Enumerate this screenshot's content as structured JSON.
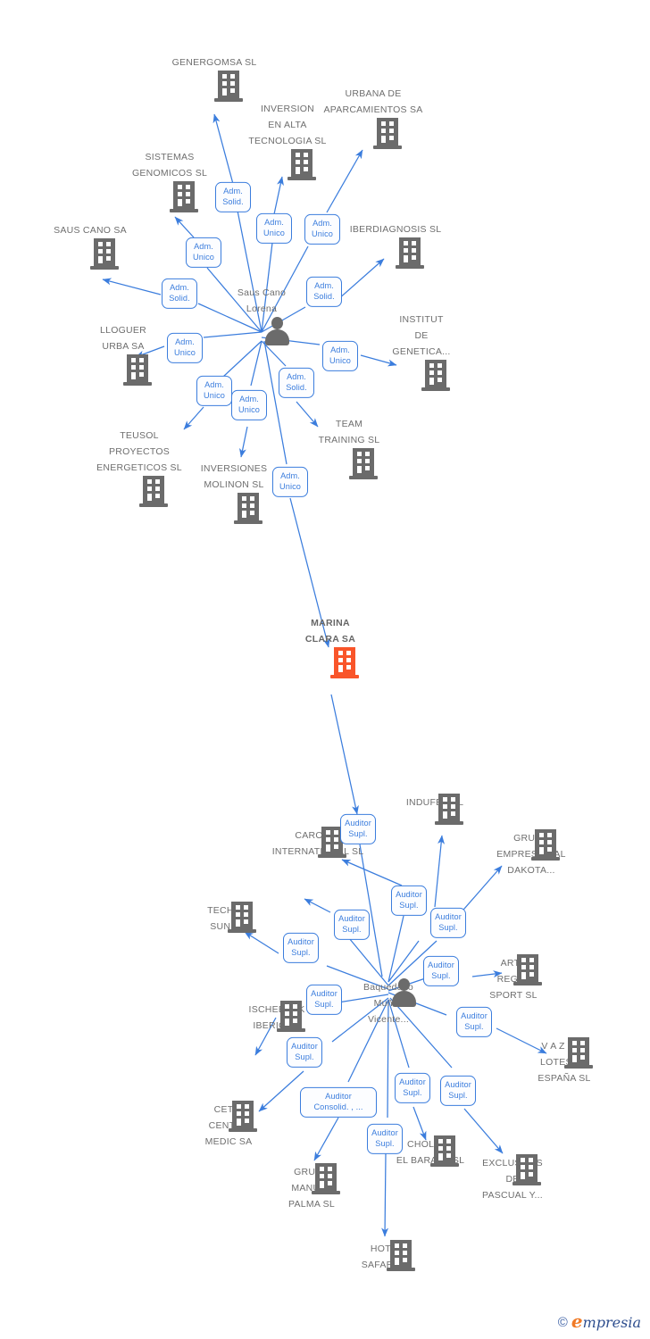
{
  "meta": {
    "colors": {
      "node_grey": "#6b6b6b",
      "focus_orange": "#f9552a",
      "edge_blue": "#3b7ddd",
      "label_text": "#6e6e6e",
      "chip_text": "#3b7ddd",
      "background": "#ffffff"
    }
  },
  "focus": {
    "label": "MARINA\nCLARA SA",
    "icon": "building-icon",
    "color": "#f9552a"
  },
  "people": [
    {
      "id": "p1",
      "label": "Saus Cano\nLorena",
      "icon": "person-icon"
    },
    {
      "id": "p2",
      "label": "Baquedano\nMuñoz\nVicente...",
      "icon": "person-icon"
    }
  ],
  "companies": [
    {
      "id": "c01",
      "label": "GENERGOMSA SL",
      "icon": "building-icon"
    },
    {
      "id": "c02",
      "label": "INVERSION\nEN ALTA\nTECNOLOGIA SL",
      "icon": "building-icon"
    },
    {
      "id": "c03",
      "label": "URBANA DE\nAPARCAMIENTOS SA",
      "icon": "building-icon"
    },
    {
      "id": "c04",
      "label": "SISTEMAS\nGENOMICOS SL",
      "icon": "building-icon"
    },
    {
      "id": "c05",
      "label": "IBERDIAGNOSIS SL",
      "icon": "building-icon"
    },
    {
      "id": "c06",
      "label": "SAUS CANO SA",
      "icon": "building-icon"
    },
    {
      "id": "c07",
      "label": "INSTITUT\nDE\nGENETICA...",
      "icon": "building-icon"
    },
    {
      "id": "c08",
      "label": "LLOGUER\nURBA SA",
      "icon": "building-icon"
    },
    {
      "id": "c09",
      "label": "TEUSOL\nPROYECTOS\nENERGETICOS SL",
      "icon": "building-icon"
    },
    {
      "id": "c10",
      "label": "INVERSIONES\nMOLINON SL",
      "icon": "building-icon"
    },
    {
      "id": "c11",
      "label": "TEAM\nTRAINING SL",
      "icon": "building-icon"
    },
    {
      "id": "c12",
      "label": "CAROLAY\nINTERNATIONAL SL",
      "icon": "building-icon"
    },
    {
      "id": "c13",
      "label": "INDUFEX SL",
      "icon": "building-icon"
    },
    {
      "id": "c14",
      "label": "GRUPO\nEMPRESARIAL\nDAKOTA...",
      "icon": "building-icon"
    },
    {
      "id": "c15",
      "label": "TECHNO\nSUN SL",
      "icon": "building-icon"
    },
    {
      "id": "c16",
      "label": "ARTE\nREGAL\nSPORT SL",
      "icon": "building-icon"
    },
    {
      "id": "c17",
      "label": "ISCHEBECK\nIBERICA...",
      "icon": "building-icon"
    },
    {
      "id": "c18",
      "label": "V A Z LOS\nLOTES DE\nESPAÑA SL",
      "icon": "building-icon"
    },
    {
      "id": "c19",
      "label": "CETIR\nCENTRE\nMEDIC SA",
      "icon": "building-icon"
    },
    {
      "id": "c20",
      "label": "GRUPO\nMANUEL\nPALMA SL",
      "icon": "building-icon"
    },
    {
      "id": "c21",
      "label": "CHOLLOS\nEL BARATO SL",
      "icon": "building-icon"
    },
    {
      "id": "c22",
      "label": "EXCLUSIVAS\nDE\nPASCUAL Y...",
      "icon": "building-icon"
    },
    {
      "id": "c23",
      "label": "HOTEL\nSAFARI SA",
      "icon": "building-icon"
    }
  ],
  "relations": [
    {
      "id": "r01",
      "label": "Adm.\nSolid."
    },
    {
      "id": "r02",
      "label": "Adm.\nUnico"
    },
    {
      "id": "r03",
      "label": "Adm.\nUnico"
    },
    {
      "id": "r04",
      "label": "Adm.\nUnico"
    },
    {
      "id": "r05",
      "label": "Adm.\nSolid."
    },
    {
      "id": "r06",
      "label": "Adm.\nSolid."
    },
    {
      "id": "r07",
      "label": "Adm.\nUnico"
    },
    {
      "id": "r08",
      "label": "Adm.\nUnico"
    },
    {
      "id": "r09",
      "label": "Adm.\nUnico"
    },
    {
      "id": "r10",
      "label": "Adm.\nUnico"
    },
    {
      "id": "r11",
      "label": "Adm.\nSolid."
    },
    {
      "id": "r12",
      "label": "Adm.\nUnico"
    },
    {
      "id": "r13",
      "label": "Auditor\nSupl."
    },
    {
      "id": "r14",
      "label": "Auditor\nSupl."
    },
    {
      "id": "r15",
      "label": "Auditor\nSupl."
    },
    {
      "id": "r16",
      "label": "Auditor\nSupl."
    },
    {
      "id": "r17",
      "label": "Auditor\nSupl."
    },
    {
      "id": "r18",
      "label": "Auditor\nSupl."
    },
    {
      "id": "r19",
      "label": "Auditor\nSupl."
    },
    {
      "id": "r20",
      "label": "Auditor\nSupl."
    },
    {
      "id": "r21",
      "label": "Auditor\nSupl."
    },
    {
      "id": "r22",
      "label": "Auditor\nSupl."
    },
    {
      "id": "r23",
      "label": "Auditor\nConsolid. , ..."
    },
    {
      "id": "r24",
      "label": "Auditor\nSupl."
    },
    {
      "id": "r25",
      "label": "Auditor\nSupl."
    },
    {
      "id": "r26",
      "label": "Auditor\nSupl."
    }
  ],
  "watermark": {
    "copyright": "©",
    "brand_e": "e",
    "brand_rest": "mpresia"
  }
}
